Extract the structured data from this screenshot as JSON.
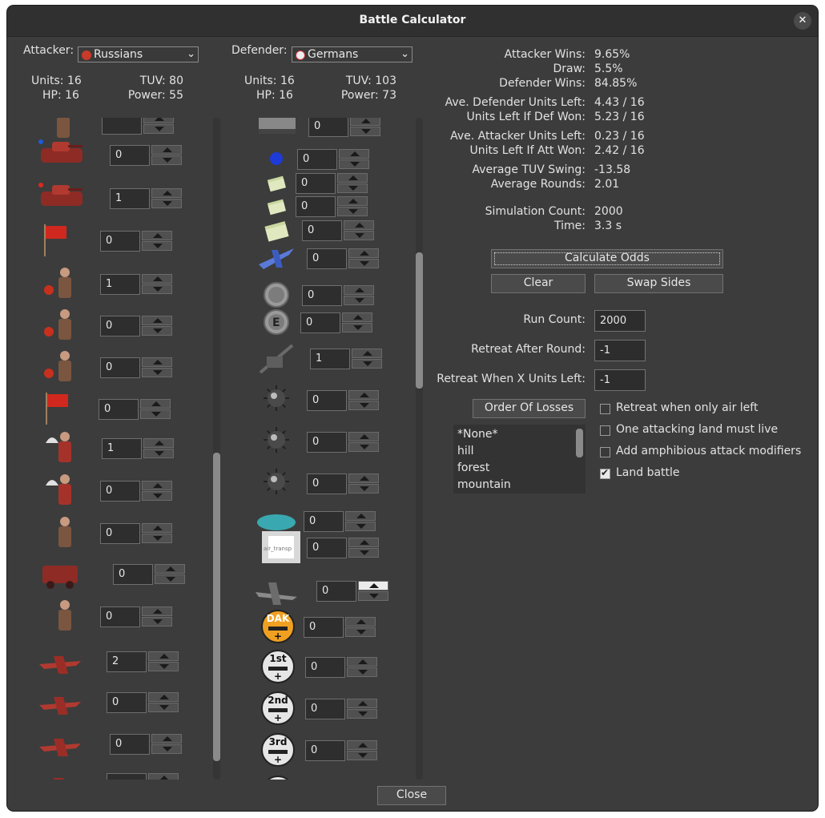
{
  "window": {
    "title": "Battle Calculator",
    "close_glyph": "✕"
  },
  "attacker": {
    "label": "Attacker:",
    "nation": "Russians",
    "stats": {
      "units_label": "Units: 16",
      "tuv_label": "TUV: 80",
      "hp_label": "HP: 16",
      "power_label": "Power: 55"
    },
    "units": [
      {
        "icon": "soviet-infantry-icon",
        "value": ""
      },
      {
        "icon": "soviet-tank-blue-marker-icon",
        "value": "0"
      },
      {
        "icon": "soviet-tank-red-marker-icon",
        "value": "1"
      },
      {
        "icon": "soviet-flag-icon",
        "value": "0"
      },
      {
        "icon": "soviet-officer-icon",
        "value": "1"
      },
      {
        "icon": "soviet-soldier-icon",
        "value": "0"
      },
      {
        "icon": "soviet-soldier-2-icon",
        "value": "0"
      },
      {
        "icon": "soviet-banner-icon",
        "value": "0"
      },
      {
        "icon": "soviet-paratrooper-icon",
        "value": "1"
      },
      {
        "icon": "soviet-paratrooper-2-icon",
        "value": "0"
      },
      {
        "icon": "soviet-rifleman-icon",
        "value": "0"
      },
      {
        "icon": "soviet-truck-icon",
        "value": "0"
      },
      {
        "icon": "soviet-guard-icon",
        "value": "0"
      },
      {
        "icon": "soviet-fighter-icon",
        "value": "2"
      },
      {
        "icon": "soviet-bomber-icon",
        "value": "0"
      },
      {
        "icon": "soviet-heavy-bomber-icon",
        "value": "0"
      },
      {
        "icon": "soviet-plane-icon",
        "value": ""
      }
    ]
  },
  "defender": {
    "label": "Defender:",
    "nation": "Germans",
    "stats": {
      "units_label": "Units: 16",
      "tuv_label": "TUV: 103",
      "hp_label": "HP: 16",
      "power_label": "Power: 73"
    },
    "units": [
      {
        "icon": "german-halftrack-icon",
        "value": "0"
      },
      {
        "icon": "blue-dot-icon",
        "value": "0"
      },
      {
        "icon": "money-small-icon",
        "value": "0"
      },
      {
        "icon": "money-small-2-icon",
        "value": "0"
      },
      {
        "icon": "money-large-icon",
        "value": "0"
      },
      {
        "icon": "german-fighter-icon",
        "value": "0"
      },
      {
        "icon": "gear-token-icon",
        "value": "0"
      },
      {
        "icon": "e-token-icon",
        "value": "0"
      },
      {
        "icon": "anti-tank-gun-icon",
        "value": "1"
      },
      {
        "icon": "mine-icon",
        "value": "0"
      },
      {
        "icon": "mine-2-icon",
        "value": "0"
      },
      {
        "icon": "mine-3-icon",
        "value": "0"
      },
      {
        "icon": "cyan-disc-icon",
        "value": "0"
      },
      {
        "icon": "air-transport-placeholder-icon",
        "value": "0",
        "caption": "air_transp"
      },
      {
        "icon": "german-bomber-icon",
        "value": "0"
      },
      {
        "icon": "dak-badge-icon",
        "value": "0",
        "caption": "DAK"
      },
      {
        "icon": "1st-division-badge-icon",
        "value": "0",
        "caption": "1st"
      },
      {
        "icon": "2nd-division-badge-icon",
        "value": "0",
        "caption": "2nd"
      },
      {
        "icon": "3rd-division-badge-icon",
        "value": "0",
        "caption": "3rd"
      },
      {
        "icon": "division-badge-icon",
        "value": ""
      }
    ]
  },
  "results": [
    {
      "label": "Attacker Wins:",
      "value": "9.65%"
    },
    {
      "label": "Draw:",
      "value": "5.5%"
    },
    {
      "label": "Defender Wins:",
      "value": "84.85%"
    },
    {
      "label": "Ave. Defender Units Left:",
      "value": "4.43 / 16"
    },
    {
      "label": "Units Left If Def Won:",
      "value": "5.23 / 16"
    },
    {
      "label": "Ave. Attacker Units Left:",
      "value": "0.23 / 16"
    },
    {
      "label": "Units Left If Att Won:",
      "value": "2.42 / 16"
    },
    {
      "label": "Average TUV Swing:",
      "value": "-13.58"
    },
    {
      "label": "Average Rounds:",
      "value": "2.01"
    },
    {
      "label": "Simulation Count:",
      "value": "2000"
    },
    {
      "label": "Time:",
      "value": "3.3 s"
    }
  ],
  "buttons": {
    "calculate": "Calculate Odds",
    "clear": "Clear",
    "swap": "Swap Sides",
    "order_of_losses": "Order Of Losses",
    "close": "Close"
  },
  "settings": {
    "run_count_label": "Run Count:",
    "run_count": "2000",
    "retreat_round_label": "Retreat After Round:",
    "retreat_round": "-1",
    "retreat_units_label": "Retreat When X Units Left:",
    "retreat_units": "-1"
  },
  "checkboxes": [
    {
      "label": "Retreat when only air left",
      "checked": false
    },
    {
      "label": "One attacking land must live",
      "checked": false
    },
    {
      "label": "Add amphibious attack modifiers",
      "checked": false
    },
    {
      "label": "Land battle",
      "checked": true
    }
  ],
  "terrain_list": [
    "*None*",
    "hill",
    "forest",
    "mountain"
  ],
  "colors": {
    "soviet_red": "#b03a30",
    "german_blue": "#1e3ad8",
    "window_bg": "#3c3c3c"
  }
}
